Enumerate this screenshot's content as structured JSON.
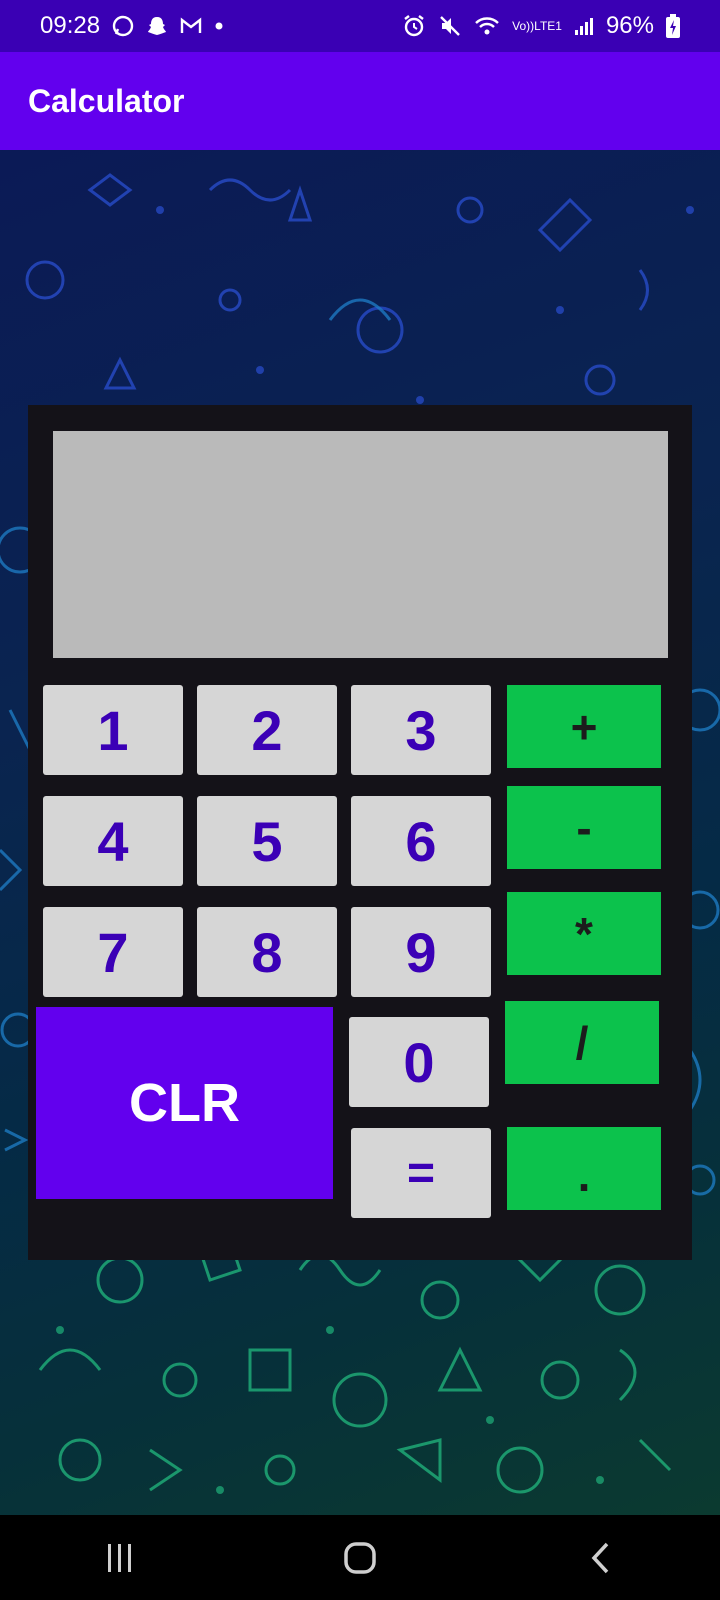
{
  "status_bar": {
    "time": "09:28",
    "network_label_top": "Vo))",
    "network_label_bottom": "LTE1",
    "battery": "96%",
    "notification_icons": [
      "whatsapp-icon",
      "snapchat-icon",
      "gmail-icon",
      "dot-icon"
    ],
    "system_icons": [
      "alarm-icon",
      "mute-icon",
      "wifi-icon",
      "signal-icon",
      "battery-icon"
    ]
  },
  "app_bar": {
    "title": "Calculator"
  },
  "display": {
    "value": ""
  },
  "keys": {
    "k1": "1",
    "k2": "2",
    "k3": "3",
    "k4": "4",
    "k5": "5",
    "k6": "6",
    "k7": "7",
    "k8": "8",
    "k9": "9",
    "k0": "0",
    "equals": "=",
    "clear": "CLR",
    "plus": "+",
    "minus": "-",
    "multiply": "*",
    "divide": "/",
    "dot": "."
  },
  "colors": {
    "status_bar": "#3a00b4",
    "app_bar": "#6200ee",
    "panel": "#141218",
    "display": "#bababa",
    "digit_key": "#d6d6d6",
    "digit_text": "#3b00b6",
    "operator_key": "#0cc24c",
    "clear_key": "#6200ee"
  },
  "nav_bar": {
    "icons": [
      "recent-apps-icon",
      "home-icon",
      "back-icon"
    ]
  }
}
